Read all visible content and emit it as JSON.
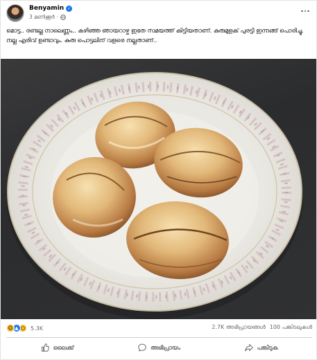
{
  "post": {
    "author": "Benyamin",
    "timestamp": "3 മണിക്കൂർ",
    "separator": "·",
    "text": "മൊട്ട.. രണ്ടല്ല നാലെണ്ണം.. കഴിഞ്ഞ ഞായറാഴ്ച ഇതേ സമയത്ത് കിട്ടിയതാണ്. കുരുമുളക് പുരട്ടി ഇന്നങ്ങ് പൊരിച്ചു.  നല്ല എരിവ് ഉണ്ടാവും. കുരു പൊട്ടലിന് വളരെ നല്ലതാണ്.."
  },
  "stats": {
    "reaction_count": "5.3K",
    "comments": "2.7K അഭിപ്രായങ്ങൾ",
    "shares": "100 പങ്കിടലുകൾ"
  },
  "actions": {
    "like_label": "ലൈക്ക്",
    "comment_label": "അഭിപ്രായം",
    "share_label": "പങ്കിടുക"
  },
  "colors": {
    "brand_blue": "#1877f2",
    "secondary_text": "#65676b",
    "divider": "#ced0d4"
  },
  "icons": {
    "verified": "verified-badge-icon",
    "audience": "globe-icon",
    "like": "thumbs-up-icon",
    "comment": "comment-bubble-icon",
    "share": "share-arrow-icon"
  }
}
